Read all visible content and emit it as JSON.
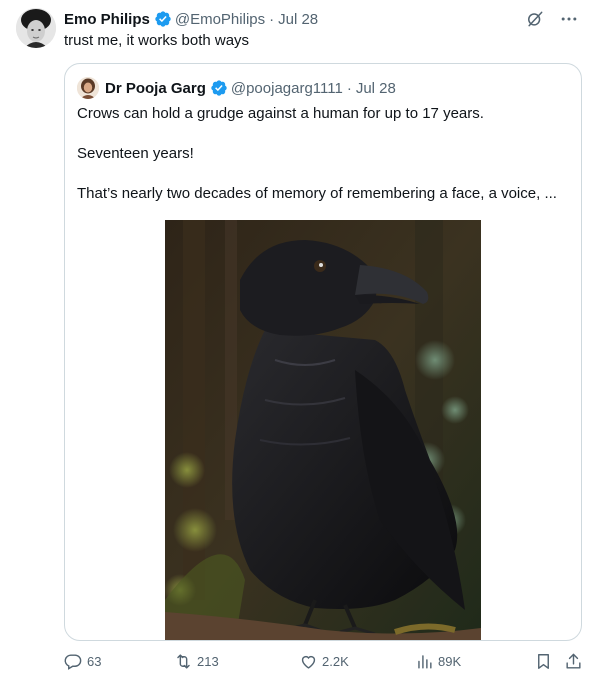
{
  "author": {
    "name": "Emo Philips",
    "handle": "@EmoPhilips",
    "date": "Jul 28",
    "avatar_icon": "portrait-icon"
  },
  "tweet_text": "trust me, it works both ways",
  "separator": "·",
  "quoted": {
    "name": "Dr Pooja Garg",
    "handle": "@poojagarg1111",
    "date": "Jul 28",
    "paragraphs": [
      "Crows can hold a grudge against a human for up to 17 years.",
      "Seventeen years!",
      "That’s nearly two decades of memory of remembering a face, a voice, ..."
    ],
    "media_icon": "crow-photo"
  },
  "engagement": {
    "replies": "63",
    "reposts": "213",
    "likes": "2.2K",
    "views": "89K"
  },
  "colors": {
    "text": "#0f1419",
    "muted": "#536471",
    "border": "#cfd9de",
    "verified": "#1d9bf0"
  }
}
